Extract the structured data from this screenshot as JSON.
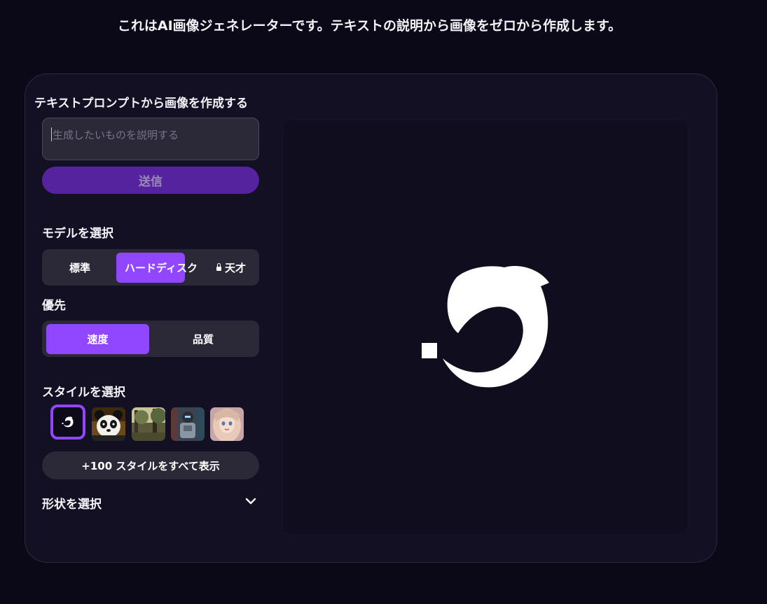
{
  "intro_text": "これはAI画像ジェネレーターです。テキストの説明から画像をゼロから作成します。",
  "panel": {
    "title": "テキストプロンプトから画像を作成する",
    "prompt": {
      "value": "",
      "placeholder": "生成したいものを説明する"
    },
    "submit_label": "送信",
    "model": {
      "label": "モデルを選択",
      "options": [
        "標準",
        "ハードディスク",
        "天才"
      ],
      "selected": "ハードディスク",
      "locked": [
        "天才"
      ]
    },
    "priority": {
      "label": "優先",
      "options": [
        "速度",
        "品質"
      ],
      "selected": "速度"
    },
    "style": {
      "label": "スタイルを選択",
      "thumbnails": [
        "dolphin-logo-default",
        "panda",
        "forest-landscape",
        "cyborg-robot",
        "anime-girl"
      ],
      "selected": "dolphin-logo-default",
      "show_all_label": "+100 スタイルをすべて表示"
    },
    "shape": {
      "label": "形状を選択"
    }
  },
  "colors": {
    "accent": "#9147ff",
    "submit": "#55239d",
    "background": "#0b0818",
    "card": "#131023",
    "input": "#2b2838"
  },
  "preview": {
    "icon": "dolphin-logo-icon"
  }
}
